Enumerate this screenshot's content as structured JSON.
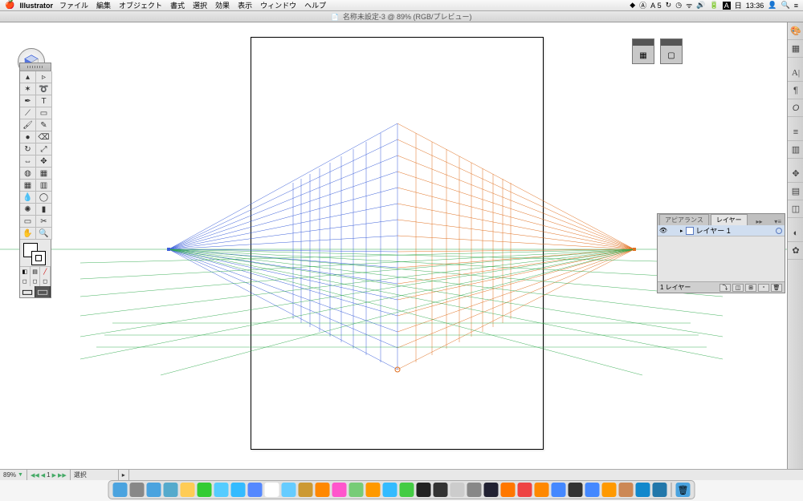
{
  "menubar": {
    "app": "Illustrator",
    "items": [
      "ファイル",
      "編集",
      "オブジェクト",
      "書式",
      "選択",
      "効果",
      "表示",
      "ウィンドウ",
      "ヘルプ"
    ],
    "right": {
      "day": "日",
      "time": "13:36",
      "battery": "⚡",
      "adobe": "A",
      "adobe_num": "5"
    }
  },
  "document": {
    "title": "名称未設定-3 @ 89% (RGB/プレビュー)"
  },
  "status": {
    "zoom": "89%",
    "artboard_nav": "1",
    "sel_label": "選択"
  },
  "layers": {
    "tab_appearance": "アピアランス",
    "tab_layers": "レイヤー",
    "layer1": "レイヤー 1",
    "footer_count": "1 レイヤー"
  },
  "right_strip": {
    "items": [
      "color",
      "swatches",
      "divider",
      "char",
      "para",
      "opentype",
      "divider",
      "stroke",
      "gradient",
      "divider",
      "transform",
      "align",
      "pathfinder",
      "divider",
      "brushes",
      "symbols",
      "divider",
      "doc"
    ]
  },
  "tools": {
    "rows": [
      [
        "selection",
        "direct-selection"
      ],
      [
        "magic-wand",
        "lasso"
      ],
      [
        "pen",
        "type"
      ],
      [
        "line",
        "rectangle"
      ],
      [
        "paintbrush",
        "pencil"
      ],
      [
        "blob-brush",
        "eraser"
      ],
      [
        "rotate",
        "scale"
      ],
      [
        "width",
        "free-transform"
      ],
      [
        "shape-builder",
        "perspective-grid"
      ],
      [
        "mesh",
        "gradient"
      ],
      [
        "eyedropper",
        "blend"
      ],
      [
        "symbol-sprayer",
        "column-graph"
      ],
      [
        "artboard",
        "slice"
      ],
      [
        "hand",
        "zoom"
      ]
    ]
  },
  "dock": {
    "items": [
      "finder",
      "launchpad",
      "safari",
      "mail",
      "notes",
      "line",
      "twitter",
      "skype",
      "appstore",
      "calendar",
      "preview",
      "contacts",
      "reminders",
      "itunes",
      "maps",
      "ibooks",
      "messages",
      "facetime",
      "terminal",
      "activity",
      "textedit",
      "settings",
      "steam",
      "vlc",
      "chrome",
      "firefox",
      "xcode",
      "unity",
      "illustrator",
      "bridge",
      "photoshop",
      "word",
      "excel",
      "sep",
      "trash"
    ]
  },
  "colors": {
    "left_plane": "#3b5fd9",
    "right_plane": "#e07020",
    "floor_plane": "#2ba84a"
  }
}
